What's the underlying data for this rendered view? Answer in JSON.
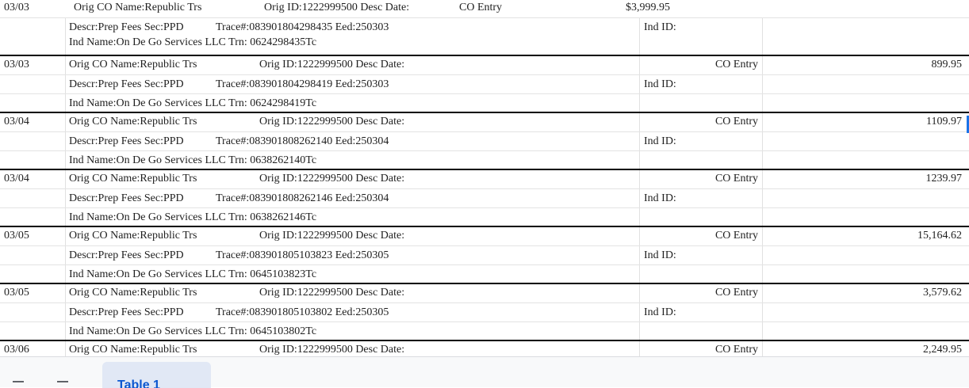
{
  "top_row": {
    "date": "03/03",
    "orig_co": "Orig CO Name:Republic Trs",
    "orig_id": "Orig ID:1222999500 Desc Date:",
    "co_entry": "CO Entry",
    "amount": "$3,999.95",
    "descr": "Descr:Prep Fees Sec:PPD",
    "trace": "Trace#:083901804298435 Eed:250303",
    "ind_id": "Ind ID:",
    "ind_name": "Ind Name:On De Go Services LLC Trn: 0624298435Tc"
  },
  "entries": [
    {
      "date": "03/03",
      "orig_co": "Orig CO Name:Republic Trs",
      "orig_id": "Orig ID:1222999500 Desc Date:",
      "co_entry": "CO Entry",
      "amount": "899.95",
      "descr": "Descr:Prep Fees Sec:PPD",
      "trace": "Trace#:083901804298419 Eed:250303",
      "ind_id": "Ind ID:",
      "ind_name": "Ind Name:On De Go Services LLC Trn: 0624298419Tc"
    },
    {
      "date": "03/04",
      "orig_co": "Orig CO Name:Republic Trs",
      "orig_id": "Orig ID:1222999500 Desc Date:",
      "co_entry": "CO Entry",
      "amount": "1109.97",
      "descr": "Descr:Prep Fees Sec:PPD",
      "trace": "Trace#:083901808262140 Eed:250304",
      "ind_id": "Ind ID:",
      "ind_name": "Ind Name:On De Go Services LLC Trn: 0638262140Tc"
    },
    {
      "date": "03/04",
      "orig_co": "Orig CO Name:Republic Trs",
      "orig_id": "Orig ID:1222999500 Desc Date:",
      "co_entry": "CO Entry",
      "amount": "1239.97",
      "descr": "Descr:Prep Fees Sec:PPD",
      "trace": "Trace#:083901808262146 Eed:250304",
      "ind_id": "Ind ID:",
      "ind_name": "Ind Name:On De Go Services LLC Trn: 0638262146Tc"
    },
    {
      "date": "03/05",
      "orig_co": "Orig CO Name:Republic Trs",
      "orig_id": "Orig ID:1222999500 Desc Date:",
      "co_entry": "CO Entry",
      "amount": "15,164.62",
      "descr": "Descr:Prep Fees Sec:PPD",
      "trace": "Trace#:083901805103823 Eed:250305",
      "ind_id": "Ind ID:",
      "ind_name": "Ind Name:On De Go Services LLC Trn: 0645103823Tc"
    },
    {
      "date": "03/05",
      "orig_co": "Orig CO Name:Republic Trs",
      "orig_id": "Orig ID:1222999500 Desc Date:",
      "co_entry": "CO Entry",
      "amount": "3,579.62",
      "descr": "Descr:Prep Fees Sec:PPD",
      "trace": "Trace#:083901805103802 Eed:250305",
      "ind_id": "Ind ID:",
      "ind_name": "Ind Name:On De Go Services LLC Trn: 0645103802Tc"
    },
    {
      "date": "03/06",
      "orig_co": "Orig CO Name:Republic Trs",
      "orig_id": "Orig ID:1222999500 Desc Date:",
      "co_entry": "CO Entry",
      "amount": "2,249.95",
      "descr": "",
      "trace": "",
      "ind_id": "",
      "ind_name": ""
    }
  ],
  "tabbar": {
    "add_icon": "plus-icon",
    "menu_icon": "menu-icon",
    "sheet_tab": "Table 1",
    "accent": "#0b57d0"
  }
}
